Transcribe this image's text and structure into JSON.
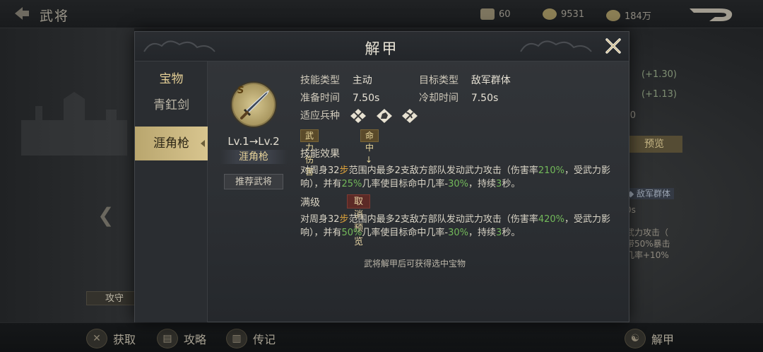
{
  "topbar": {
    "title": "武将",
    "resources": [
      {
        "icon": "token-icon",
        "value": "60"
      },
      {
        "icon": "copper-coin-icon",
        "value": "9531"
      },
      {
        "icon": "silver-icon",
        "value": "184万"
      }
    ]
  },
  "scene": {
    "right_stats": [
      "(+1.30)",
      "(+1.13)"
    ],
    "right_zero": "0",
    "preview_button": "预览",
    "right_tag": "敌军群体",
    "right_lines": [
      "0s",
      "武力攻击（",
      "带50%暴击",
      "几率+10%"
    ],
    "attack_defense_label": "攻守"
  },
  "modal": {
    "title": "解甲",
    "sidebar": {
      "header": "宝物",
      "items": [
        "青釭剑",
        "涯角枪"
      ],
      "active_index": 1
    },
    "weapon": {
      "rank": "S",
      "level": "Lv.1→Lv.2",
      "name": "涯角枪",
      "recommend_button": "推荐武将"
    },
    "skill": {
      "type_label": "技能类型",
      "type_value": "主动",
      "target_label": "目标类型",
      "target_value": "敌军群体",
      "prep_label": "准备时间",
      "prep_value": "7.50s",
      "cd_label": "冷却时间",
      "cd_value": "7.50s",
      "troops_label": "适应兵种",
      "troop_icons": [
        "infantry-icon",
        "cavalry-icon",
        "archer-icon"
      ],
      "tags": [
        "武力伤害",
        "命中↓"
      ],
      "effect_label": "技能效果",
      "effect_parts": {
        "p1": "对周身32",
        "p2": "步",
        "p3": "范围内最多2支敌方部队发动武力攻击（伤害率",
        "p4": "210%",
        "p5": "，受武力影响），并有",
        "p6": "25%",
        "p7": "几率使目标命中几率-",
        "p8": "30%",
        "p9": "，持续",
        "p10": "3",
        "p11": "秒。"
      },
      "max_label": "满级",
      "cancel_preview_button": "取消预览",
      "max_parts": {
        "p1": "对周身32",
        "p2": "步",
        "p3": "范围内最多2支敌方部队发动武力攻击（伤害率",
        "p4": "420%",
        "p5": "，受武力影响），并有",
        "p6": "50%",
        "p7": "几率使目标命中几率-",
        "p8": "30%",
        "p9": "，持续",
        "p10": "3",
        "p11": "秒。"
      }
    },
    "footer_note": "武将解甲后可获得选中宝物"
  },
  "bottombar": {
    "items": [
      "获取",
      "攻略",
      "传记"
    ],
    "right_item": "解甲"
  },
  "colors": {
    "accent_gold": "#d8c58f",
    "highlight_green": "#73b95a",
    "highlight_orange": "#dca23b",
    "cancel_red": "#5c2a26"
  }
}
